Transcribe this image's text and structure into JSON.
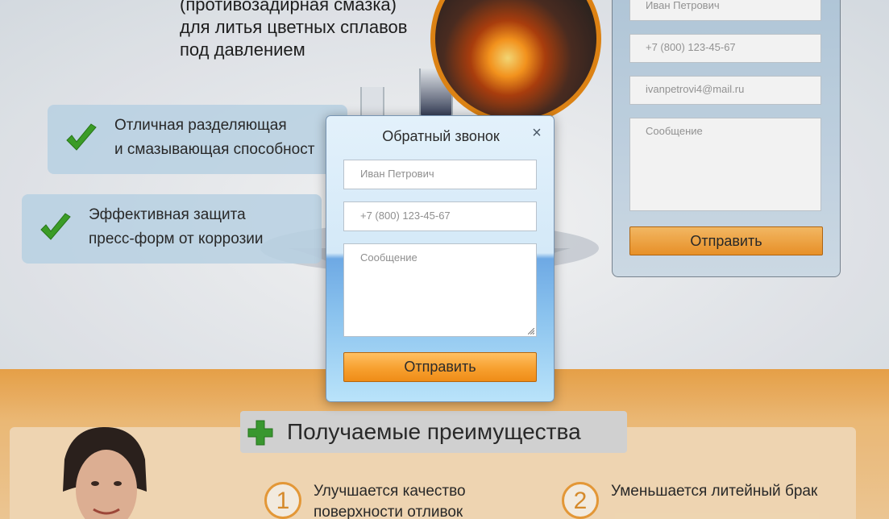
{
  "hero": {
    "title_lines": [
      "(противозадирная смазка)",
      "для литья цветных сплавов",
      "под давлением"
    ],
    "features": [
      {
        "line1": "Отличная разделяющая",
        "line2": "и смазывающая способност"
      },
      {
        "line1": "Эффективная защита",
        "line2": "пресс-форм от коррозии"
      }
    ]
  },
  "side_form": {
    "name_value": "Иван Петрович",
    "phone_value": "+7 (800) 123-45-67",
    "email_value": "ivanpetrovi4@mail.ru",
    "message_placeholder": "Сообщение",
    "submit_label": "Отправить"
  },
  "benefits": {
    "heading": "Получаемые преимущества",
    "items": [
      {
        "number": "1",
        "line1": "Улучшается качество",
        "line2": "поверхности отливок"
      },
      {
        "number": "2",
        "line1": "Уменьшается литейный брак",
        "line2": ""
      }
    ]
  },
  "modal": {
    "title": "Обратный звонок",
    "close_glyph": "×",
    "name_placeholder": "Иван Петрович",
    "phone_placeholder": "+7 (800) 123-45-67",
    "message_placeholder": "Сообщение",
    "submit_label": "Отправить"
  },
  "colors": {
    "accent_orange": "#f7a02f",
    "check_green": "#3fa52a",
    "modal_blue": "#6ea9e4"
  },
  "icons": {
    "check": "check-icon",
    "plus": "plus-icon",
    "close": "close-icon"
  }
}
